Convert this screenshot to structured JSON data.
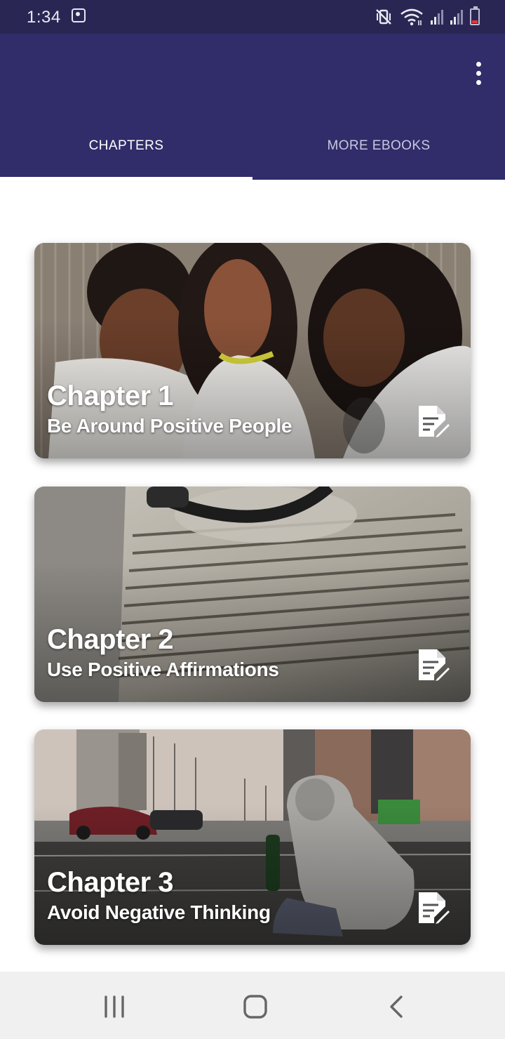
{
  "status_bar": {
    "time": "1:34",
    "icons": [
      "alarm-icon",
      "vibrate-mute-icon",
      "wifi-icon",
      "signal-icon",
      "signal-icon",
      "battery-low-icon"
    ]
  },
  "app_bar": {
    "color": "#312d6a",
    "menu_icon": "more-vertical-icon"
  },
  "tabs": [
    {
      "label": "CHAPTERS",
      "active": true
    },
    {
      "label": "MORE EBOOKS",
      "active": false
    }
  ],
  "chapters": [
    {
      "title": "Chapter 1",
      "subtitle": "Be Around Positive People",
      "icon": "document-edit-icon"
    },
    {
      "title": "Chapter 2",
      "subtitle": "Use Positive Affirmations",
      "icon": "document-edit-icon"
    },
    {
      "title": "Chapter 3",
      "subtitle": "Avoid Negative Thinking",
      "icon": "document-edit-icon"
    }
  ],
  "nav_bar": {
    "buttons": [
      "recent-apps-icon",
      "home-icon",
      "back-icon"
    ]
  }
}
